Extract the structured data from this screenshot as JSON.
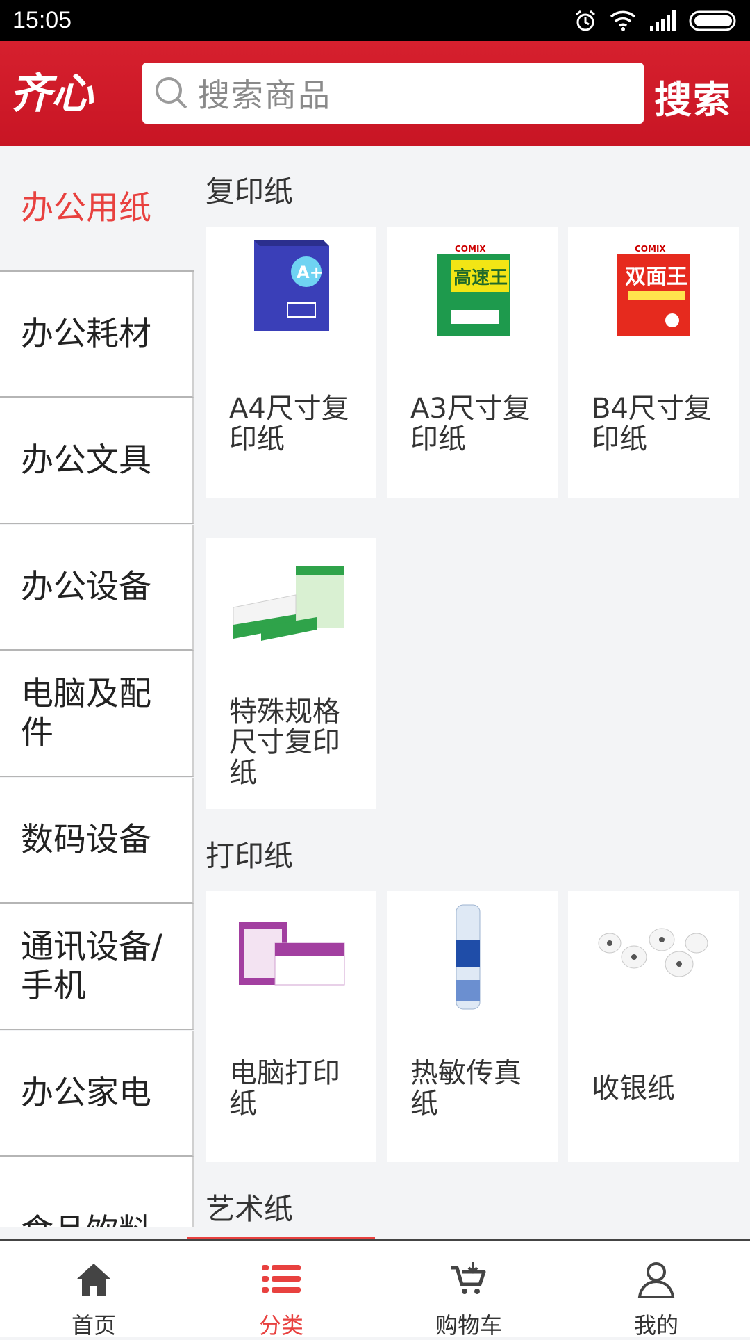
{
  "status": {
    "time": "15:05"
  },
  "header": {
    "logo": "齐心",
    "search_placeholder": "搜索商品",
    "search_button": "搜索"
  },
  "sidebar": {
    "items": [
      {
        "label": "办公用纸",
        "active": true
      },
      {
        "label": "办公耗材"
      },
      {
        "label": "办公文具"
      },
      {
        "label": "办公设备"
      },
      {
        "label": "电脑及配件"
      },
      {
        "label": "数码设备"
      },
      {
        "label": "通讯设备/手机"
      },
      {
        "label": "办公家电"
      },
      {
        "label": "食品饮料"
      }
    ]
  },
  "sections": [
    {
      "title": "复印纸",
      "products": [
        "A4尺寸复印纸",
        "A3尺寸复印纸",
        "B4尺寸复印纸",
        "特殊规格尺寸复印纸"
      ]
    },
    {
      "title": "打印纸",
      "products": [
        "电脑打印纸",
        "热敏传真纸",
        "收银纸"
      ]
    },
    {
      "title": "艺术纸"
    }
  ],
  "tabbar": {
    "tabs": [
      {
        "label": "首页",
        "icon": "home-icon"
      },
      {
        "label": "分类",
        "icon": "category-list-icon",
        "active": true
      },
      {
        "label": "购物车",
        "icon": "cart-icon"
      },
      {
        "label": "我的",
        "icon": "user-icon"
      }
    ]
  },
  "colors": {
    "brand_red": "#d21b2a",
    "active_text": "#e8413f"
  }
}
